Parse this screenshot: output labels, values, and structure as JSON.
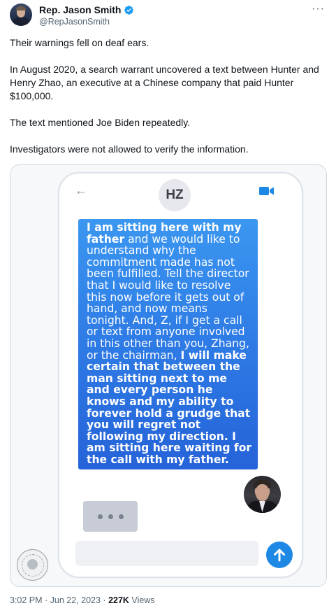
{
  "author": {
    "name": "Rep. Jason Smith",
    "handle": "@RepJasonSmith",
    "verified_color": "#1d9bf0"
  },
  "more_icon": "···",
  "tweet": {
    "paragraphs": [
      "Their warnings fell on deaf ears.",
      "In August 2020, a search warrant uncovered a text between Hunter and Henry Zhao, an executive at a Chinese company that paid Hunter $100,000.",
      "The text mentioned Joe Biden repeatedly.",
      "Investigators were not allowed to verify the information."
    ]
  },
  "media": {
    "contact_initials": "HZ",
    "back_icon": "←",
    "message_parts": [
      {
        "text": "I am sitting here with my father",
        "bold": true
      },
      {
        "text": " and we would like to understand why the commitment made has not been fulfilled.  Tell the director that I would like to resolve this now before it gets out of hand, and now means tonight.  And, Z, if I get a call or text from anyone involved in this other than you, Zhang, or the chairman, ",
        "bold": false
      },
      {
        "text": "I will make certain that between the man sitting next to me and every person he knows and my ability to forever hold a grudge that you will regret not following my direction.  I am sitting here waiting for the call with my father.",
        "bold": true
      }
    ],
    "bubble_color": "#2f7de6",
    "send_color": "#1e88e5"
  },
  "footer": {
    "time": "3:02 PM · Jun 22, 2023 · ",
    "views_count": "227K",
    "views_label": " Views"
  }
}
